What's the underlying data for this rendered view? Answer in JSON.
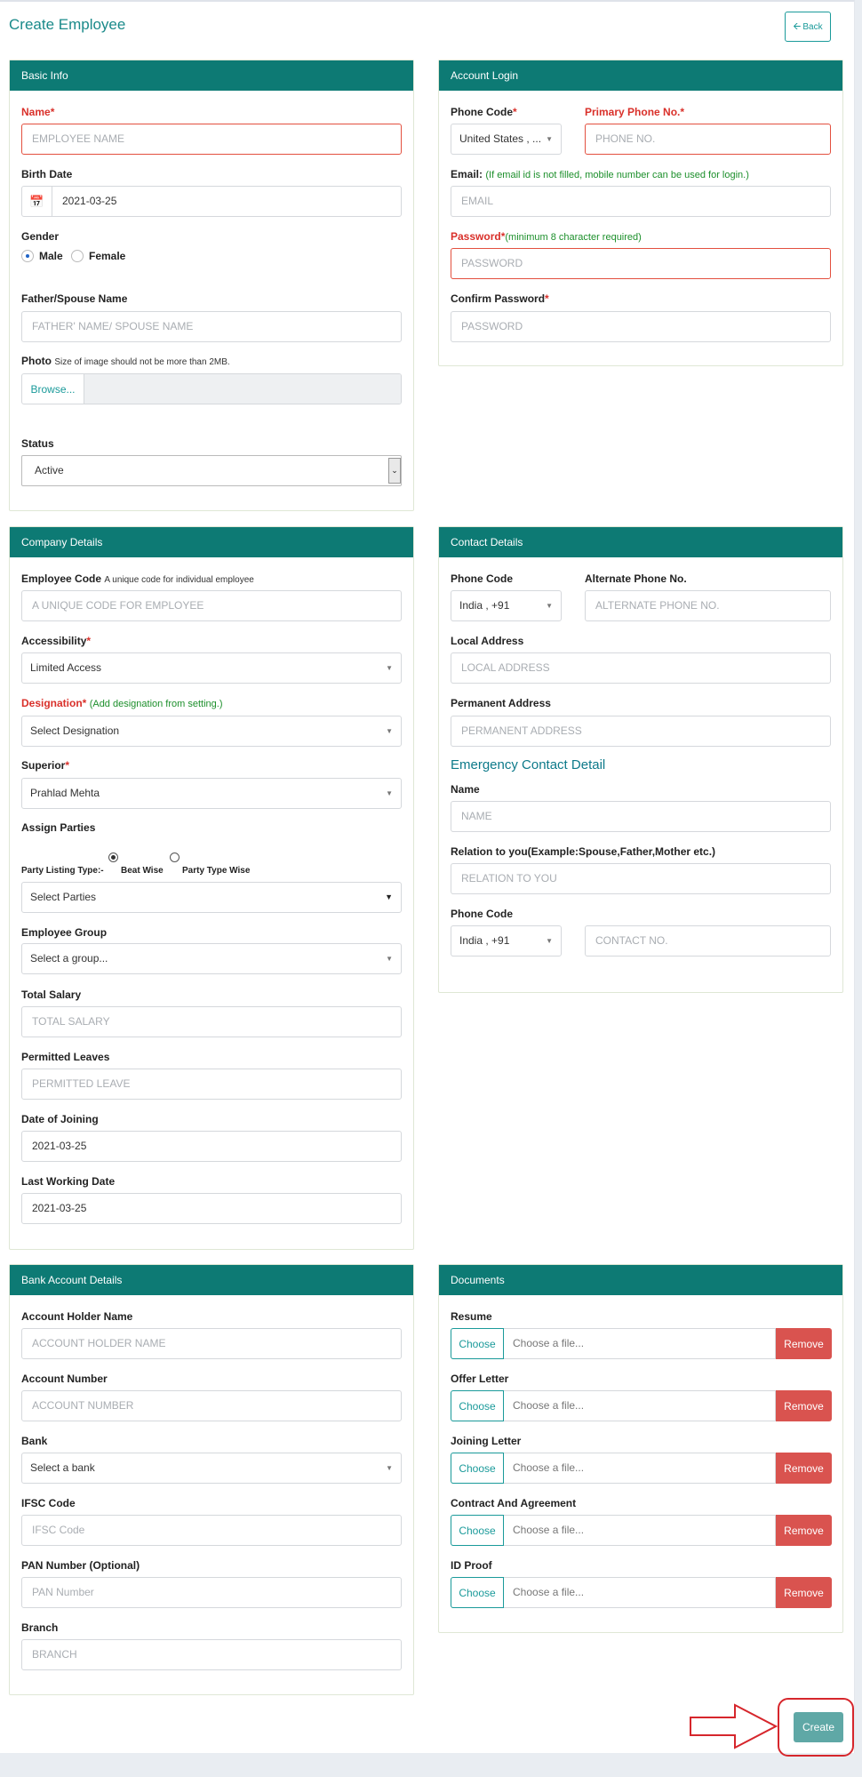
{
  "page": {
    "title": "Create Employee",
    "back_label": "Back"
  },
  "basic_info": {
    "title": "Basic Info",
    "name_label": "Name",
    "name_placeholder": "EMPLOYEE NAME",
    "birth_label": "Birth Date",
    "birth_value": "2021-03-25",
    "gender_label": "Gender",
    "gender_male": "Male",
    "gender_female": "Female",
    "father_label": "Father/Spouse Name",
    "father_placeholder": "FATHER' NAME/ SPOUSE NAME",
    "photo_label": "Photo",
    "photo_note": "Size of image should not be more than 2MB.",
    "browse_label": "Browse...",
    "status_label": "Status",
    "status_value": "Active"
  },
  "account_login": {
    "title": "Account Login",
    "phone_code_label": "Phone Code",
    "phone_code_value": "United States , ...",
    "primary_phone_label": "Primary Phone No.",
    "primary_phone_placeholder": "PHONE NO.",
    "email_label": "Email:",
    "email_note": "(If email id is not filled, mobile number can be used for login.)",
    "email_placeholder": "EMAIL",
    "password_label": "Password",
    "password_note": "(minimum 8 character required)",
    "password_placeholder": "PASSWORD",
    "confirm_label": "Confirm Password",
    "confirm_placeholder": "PASSWORD"
  },
  "company": {
    "title": "Company Details",
    "code_label": "Employee Code",
    "code_note": "A unique code for individual employee",
    "code_placeholder": "A UNIQUE CODE FOR EMPLOYEE",
    "access_label": "Accessibility",
    "access_value": "Limited Access",
    "designation_label": "Designation",
    "designation_note": "(Add designation from setting.)",
    "designation_value": "Select Designation",
    "superior_label": "Superior",
    "superior_value": "Prahlad Mehta",
    "assign_label": "Assign Parties",
    "party_listing_label": "Party Listing Type:-",
    "beat_wise": "Beat Wise",
    "party_type_wise": "Party Type Wise",
    "parties_value": "Select Parties",
    "group_label": "Employee Group",
    "group_value": "Select a group...",
    "salary_label": "Total Salary",
    "salary_placeholder": "TOTAL SALARY",
    "leaves_label": "Permitted Leaves",
    "leaves_placeholder": "PERMITTED LEAVE",
    "joining_label": "Date of Joining",
    "joining_value": "2021-03-25",
    "lastwork_label": "Last Working Date",
    "lastwork_value": "2021-03-25"
  },
  "contact": {
    "title": "Contact Details",
    "phone_code_label": "Phone Code",
    "phone_code_value": "India , +91",
    "alt_phone_label": "Alternate Phone No.",
    "alt_phone_placeholder": "ALTERNATE PHONE NO.",
    "local_label": "Local Address",
    "local_placeholder": "LOCAL ADDRESS",
    "perm_label": "Permanent Address",
    "perm_placeholder": "PERMANENT ADDRESS",
    "emergency_title": "Emergency Contact Detail",
    "name_label": "Name",
    "name_placeholder": "NAME",
    "relation_label": "Relation to you(Example:Spouse,Father,Mother etc.)",
    "relation_placeholder": "RELATION TO YOU",
    "e_phone_code_label": "Phone Code",
    "e_phone_code_value": "India , +91",
    "contact_placeholder": "CONTACT NO."
  },
  "bank": {
    "title": "Bank Account Details",
    "holder_label": "Account Holder Name",
    "holder_placeholder": "ACCOUNT HOLDER NAME",
    "number_label": "Account Number",
    "number_placeholder": "ACCOUNT NUMBER",
    "bank_label": "Bank",
    "bank_value": "Select a bank",
    "ifsc_label": "IFSC Code",
    "ifsc_placeholder": "IFSC Code",
    "pan_label": "PAN Number (Optional)",
    "pan_placeholder": "PAN Number",
    "branch_label": "Branch",
    "branch_placeholder": "BRANCH"
  },
  "documents": {
    "title": "Documents",
    "choose_label": "Choose",
    "file_placeholder": "Choose a file...",
    "remove_label": "Remove",
    "items": [
      "Resume",
      "Offer Letter",
      "Joining Letter",
      "Contract And Agreement",
      "ID Proof"
    ]
  },
  "actions": {
    "create_label": "Create"
  },
  "colors": {
    "accent": "#0d7a74",
    "danger": "#d9534f",
    "highlight": "#d6262c"
  },
  "icons": {
    "calendar": "calendar-icon",
    "back": "arrow-left-icon",
    "caret": "chevron-down-icon"
  }
}
